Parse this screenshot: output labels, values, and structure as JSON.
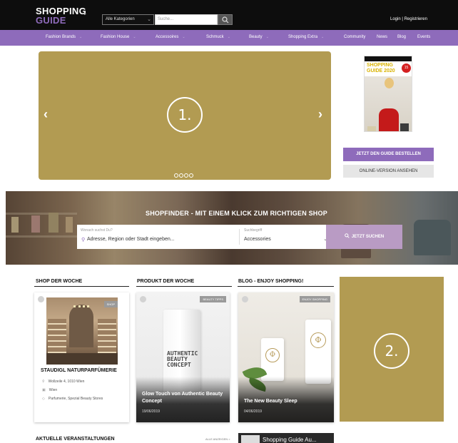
{
  "header": {
    "logo_line1": "SHOPPING",
    "logo_line2": "GUIDE",
    "category_select": "Alle Kategorien",
    "search_placeholder": "Suche...",
    "login": "Login | Registrieren"
  },
  "nav": {
    "items": [
      {
        "label": "Fashion Brands"
      },
      {
        "label": "Fashion House"
      },
      {
        "label": "Accessoires"
      },
      {
        "label": "Schmuck"
      },
      {
        "label": "Beauty"
      },
      {
        "label": "Shopping Extra"
      },
      {
        "label": "Community"
      },
      {
        "label": "News"
      },
      {
        "label": "Blog"
      },
      {
        "label": "Events"
      }
    ]
  },
  "hero": {
    "slide_number": "1.",
    "prev_icon": "chevron-left-icon",
    "next_icon": "chevron-right-icon",
    "dot_count": 4
  },
  "guide": {
    "magazine_title": "SHOPPING GUIDE 2020",
    "magazine_badge": "15",
    "order_button": "JETZT DEN GUIDE BESTELLEN",
    "online_button": "ONLINE-VERSION ANSEHEN"
  },
  "shopfinder": {
    "title": "SHOPFINDER - MIT EINEM KLICK ZUM RICHTIGEN SHOP",
    "where_label": "Wonach suchst Du?",
    "where_placeholder": "Adresse, Region oder Stadt eingeben...",
    "category_label": "Suchbegriff",
    "category_value": "Accessories",
    "search_button": "JETZT SUCHEN"
  },
  "sections": {
    "shop": {
      "title": "SHOP DER WOCHE",
      "tag": "SHOP",
      "name": "STAUDIGL NATURPARFÜMERIE",
      "info": [
        "Wollzeile 4, 1010 Wien",
        "Wien",
        "Parfumerie, Spezial Beauty Stores"
      ]
    },
    "product": {
      "title": "PRODUKT DER WOCHE",
      "tag": "BEAUTY TIPPS",
      "bottle_text": "AUTHENTIC BEAUTY CONCEPT",
      "caption": "Glow Touch von Authentic Beauty Concept",
      "date": "19/06/2019"
    },
    "blog": {
      "title": "BLOG - ENJOY SHOPPING!",
      "tag": "ENJOY SHOPPING",
      "caption": "The New Beauty Sleep",
      "date": "04/06/2019"
    }
  },
  "ad_slot": {
    "number": "2."
  },
  "events": {
    "title": "AKTUELLE VERANSTALTUNGEN",
    "link": "ALLE ANZEIGEN  >"
  },
  "video": {
    "title": "Shopping Guide Au..."
  },
  "colors": {
    "brand_purple": "#8e6bbb",
    "gold_placeholder": "#b29b52",
    "header_black": "#0d0d0d"
  }
}
